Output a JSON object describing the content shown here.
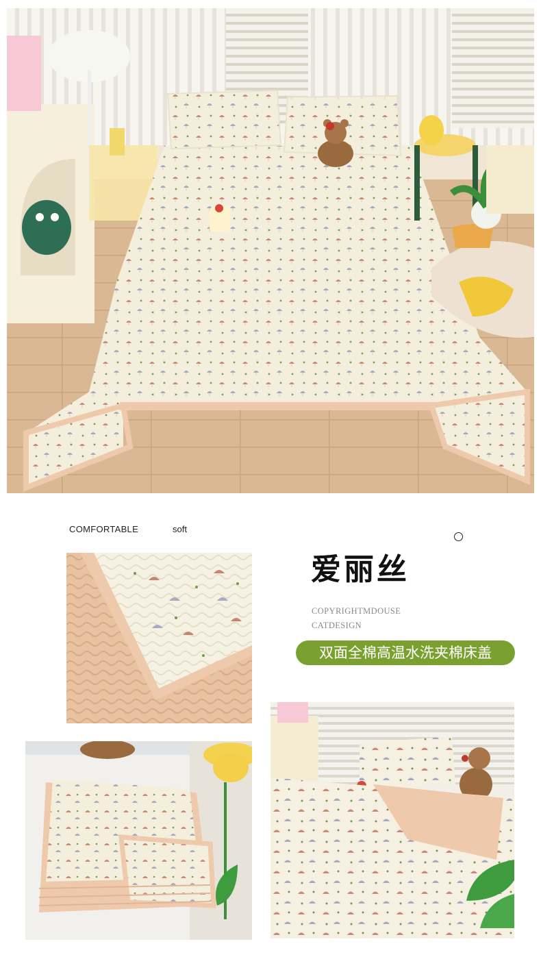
{
  "intro": {
    "label_comfortable": "COMFORTABLE",
    "label_soft": "soft"
  },
  "product": {
    "name": "爱丽丝",
    "copyright_line1": "COPYRIGHTMDOUSE",
    "copyright_line2": "CATDESIGN",
    "tagline": "双面全棉高温水洗夹棉床盖"
  },
  "colors": {
    "accent_green": "#7aa12f",
    "quilt_cream": "#f4efdc",
    "trim_peach": "#efc9ab",
    "floor_wood": "#d9b893"
  },
  "images": {
    "hero": "bed-with-mushroom-print-quilt",
    "detail": "quilt-corner-closeup",
    "folded": "folded-quilt",
    "bedside": "bed-with-bear-and-plant"
  }
}
